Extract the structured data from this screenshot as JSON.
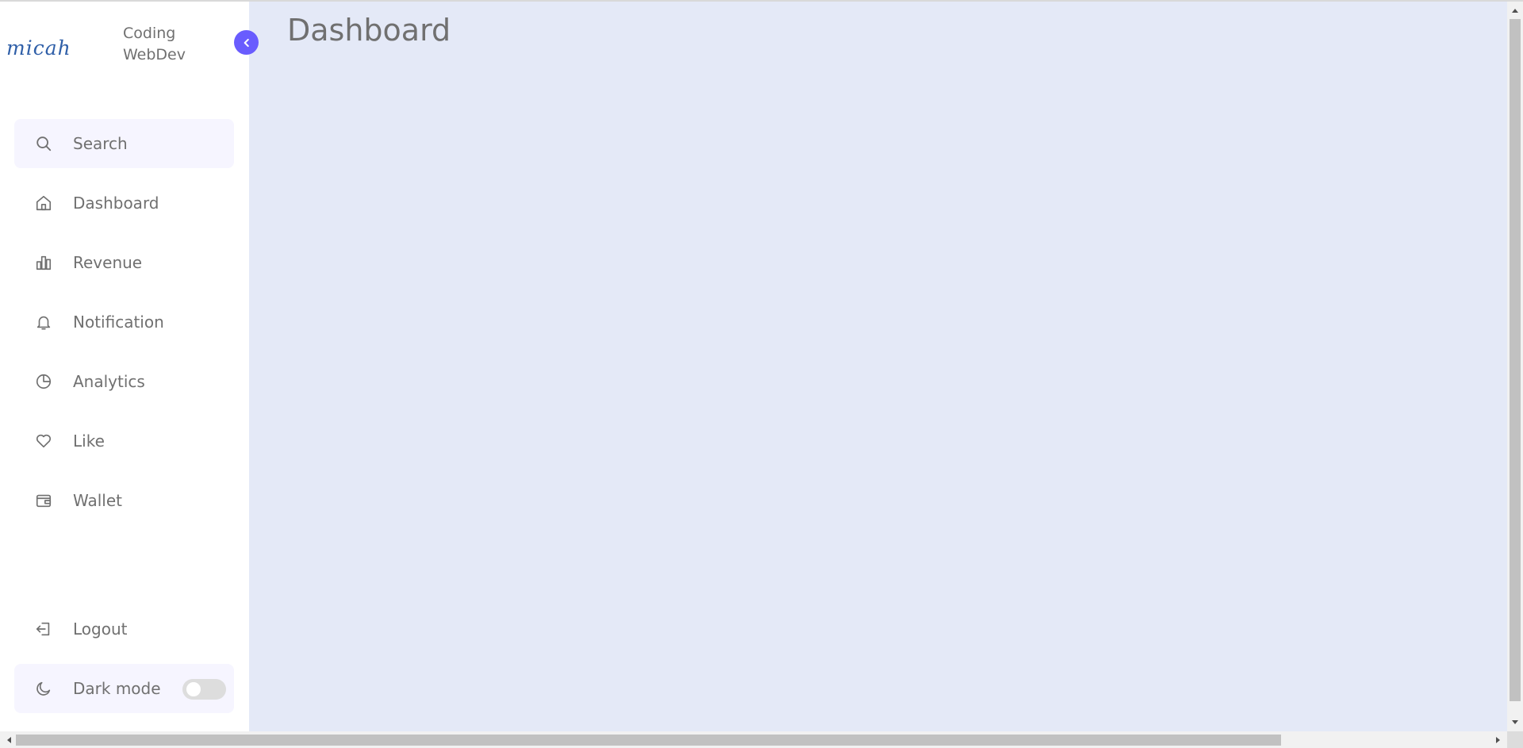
{
  "brand": {
    "logo_text": "micah",
    "name_line1": "Coding",
    "name_line2": "WebDev"
  },
  "search": {
    "placeholder": "Search",
    "icon": "search-icon"
  },
  "menu": [
    {
      "label": "Dashboard",
      "icon": "home-icon"
    },
    {
      "label": "Revenue",
      "icon": "bar-chart-icon"
    },
    {
      "label": "Notification",
      "icon": "bell-icon"
    },
    {
      "label": "Analytics",
      "icon": "pie-chart-icon"
    },
    {
      "label": "Like",
      "icon": "heart-icon"
    },
    {
      "label": "Wallet",
      "icon": "wallet-icon"
    }
  ],
  "bottom": {
    "logout_label": "Logout",
    "dark_mode_label": "Dark mode",
    "dark_mode_on": false
  },
  "main": {
    "title": "Dashboard"
  },
  "colors": {
    "accent": "#695cfe",
    "background": "#e4e9f7",
    "sidebar": "#ffffff",
    "text": "#707070",
    "highlight": "#f6f5ff"
  }
}
